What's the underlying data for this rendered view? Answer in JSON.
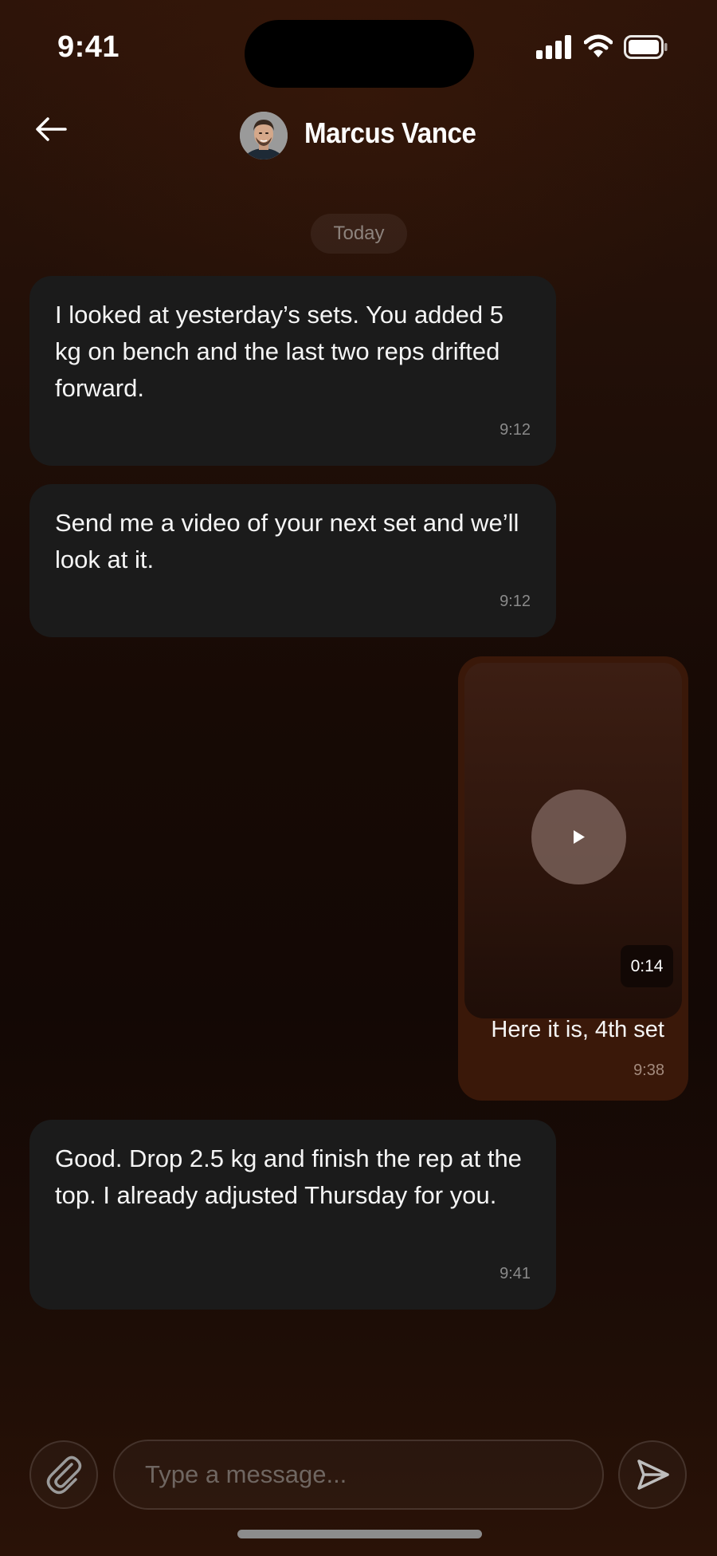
{
  "status_bar": {
    "time": "9:41"
  },
  "header": {
    "contact_name": "Marcus Vance",
    "back_icon": "arrow-left-icon"
  },
  "date_separator": "Today",
  "messages": [
    {
      "text": "I looked at yesterday’s sets. You added 5 kg on bench and the last two reps drifted forward.",
      "time": "9:12"
    },
    {
      "text": "Send me a video of your next set and we’ll look at it.",
      "time": "9:12"
    },
    {
      "video_duration": "0:14",
      "caption": "Here it is, 4th set",
      "time": "9:38"
    },
    {
      "text": "Good. Drop 2.5 kg and finish the rep at the top. I already adjusted Thursday for you.",
      "time": "9:41"
    }
  ],
  "composer": {
    "placeholder": "Type a message...",
    "attach_icon": "paperclip-icon",
    "send_icon": "send-icon"
  },
  "colors": {
    "incoming_bubble": "#1b1b1b",
    "outgoing_bubble": "#3a1809",
    "background_top": "#2e1409"
  }
}
